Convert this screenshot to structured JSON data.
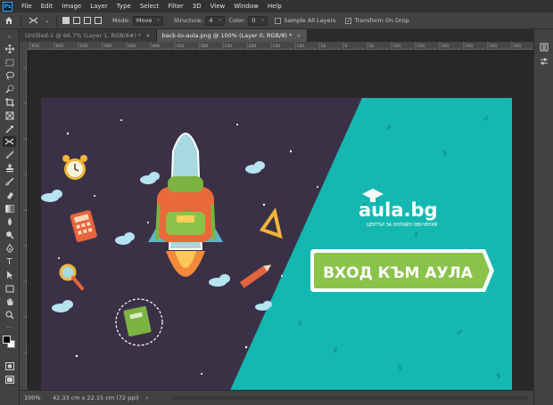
{
  "menubar": {
    "app_icon_label": "Ps",
    "items": [
      "File",
      "Edit",
      "Image",
      "Layer",
      "Type",
      "Select",
      "Filter",
      "3D",
      "View",
      "Window",
      "Help"
    ]
  },
  "options_bar": {
    "mode_label": "Mode:",
    "mode_value": "Move",
    "structure_label": "Structure:",
    "structure_value": "4",
    "color_label": "Color:",
    "color_value": "0",
    "sample_all_layers_label": "Sample All Layers",
    "sample_all_layers_checked": false,
    "transform_on_drop_label": "Transform On Drop",
    "transform_on_drop_checked": true
  },
  "tabs": [
    {
      "label": "Untitled-1 @ 66.7% (Layer 1, RGB/8#) *",
      "active": false
    },
    {
      "label": "back-to-aula.png @ 100% (Layer 0, RGB/8) *",
      "active": true
    }
  ],
  "ruler_top": [
    "650",
    "600",
    "550",
    "500",
    "450",
    "400",
    "350",
    "300",
    "250",
    "200",
    "150",
    "100",
    "50",
    "0",
    "50",
    "100",
    "150",
    "200",
    "250",
    "300",
    "350"
  ],
  "banner": {
    "logo_brand": "aula.bg",
    "logo_tagline": "ЦЕНТЪР ЗА ОНЛАЙН ОБУЧЕНИЯ",
    "cta_label": "ВХОД КЪМ АУЛА",
    "colors": {
      "dark_bg": "#3b3147",
      "teal_bg": "#14b8b0",
      "cta_green": "#8bc34a",
      "rocket_body": "#a8d8e0",
      "backpack": "#e86a3a"
    }
  },
  "status": {
    "zoom": "100%",
    "doc_info": "42.33 cm x 22.15 cm (72 ppi)",
    "arrow": "›"
  },
  "colors": {
    "foreground": "#000000",
    "background": "#ffffff"
  }
}
